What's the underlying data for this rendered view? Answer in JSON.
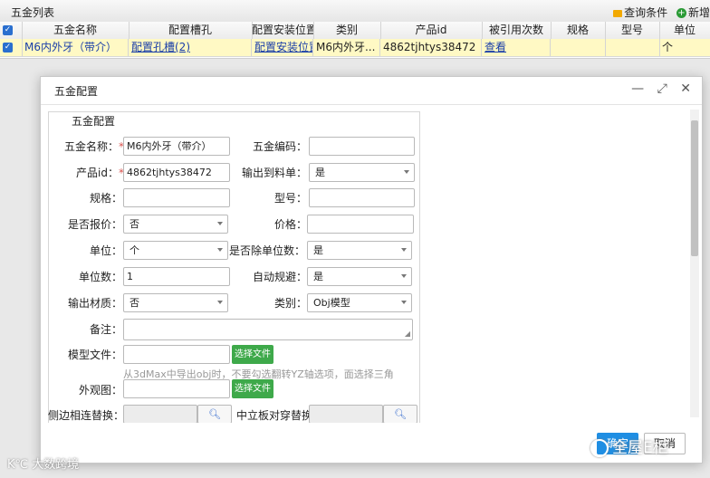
{
  "panel": {
    "title": "五金列表",
    "query_label": "查询条件",
    "add_label": "新增"
  },
  "grid": {
    "columns": [
      "五金名称",
      "配置槽孔",
      "配置安装位置",
      "类别",
      "产品id",
      "被引用次数",
      "规格",
      "型号",
      "单位"
    ],
    "row": {
      "name": "M6内外牙（带介）",
      "slot": "配置孔槽(2)",
      "install": "配置安装位置",
      "category": "M6内外牙...",
      "product_id": "4862tjhtys38472",
      "ref": "查看",
      "spec": "",
      "model": "",
      "unit": "个"
    }
  },
  "dialog": {
    "title": "五金配置",
    "group_title": "五金配置",
    "buttons": {
      "minimize": "—",
      "maximize": "⤢",
      "close": "✕"
    },
    "fields": {
      "name": {
        "label": "五金名称：",
        "value": "M6内外牙（带介）"
      },
      "code": {
        "label": "五金编码：",
        "value": ""
      },
      "product_id": {
        "label": "产品id：",
        "value": "4862tjhtys38472"
      },
      "output_bom": {
        "label": "输出到料单：",
        "value": "是"
      },
      "spec": {
        "label": "规格：",
        "value": ""
      },
      "model": {
        "label": "型号：",
        "value": ""
      },
      "quote": {
        "label": "是否报价：",
        "value": "否"
      },
      "price": {
        "label": "价格：",
        "value": ""
      },
      "unit": {
        "label": "单位：",
        "value": "个"
      },
      "divide_unit": {
        "label": "是否除单位数：",
        "value": "是"
      },
      "unit_count": {
        "label": "单位数：",
        "value": "1"
      },
      "auto_avoid": {
        "label": "自动规避：",
        "value": "是"
      },
      "output_material": {
        "label": "输出材质：",
        "value": "否"
      },
      "category": {
        "label": "类别：",
        "value": "Obj模型"
      },
      "remark": {
        "label": "备注：",
        "value": ""
      },
      "model_file": {
        "label": "模型文件：",
        "value": "",
        "button": "选择文件"
      },
      "model_hint": "从3dMax中导出obj时，不要勾选翻转YZ轴选项，面选择三角",
      "appearance": {
        "label": "外观图：",
        "value": "",
        "button": "选择文件"
      },
      "side_replace": {
        "label": "侧边相连替换：",
        "value": ""
      },
      "middle_replace": {
        "label": "中立板对穿替换：",
        "value": ""
      }
    },
    "ok_label": "确定",
    "cancel_label": "取消"
  },
  "watermarks": {
    "left": "K℃ 大数跨境",
    "right": "全屋E柜"
  },
  "icons": [
    "query-icon",
    "add-icon",
    "checkbox-icon",
    "minimize-icon",
    "maximize-icon",
    "close-icon",
    "search-icon",
    "dropdown-arrow-icon",
    "wechat-icon"
  ],
  "colors": {
    "accent": "#1f8ee3",
    "file_button": "#3ea94a",
    "required": "#d9534f",
    "selected_row": "#fff9c4"
  }
}
